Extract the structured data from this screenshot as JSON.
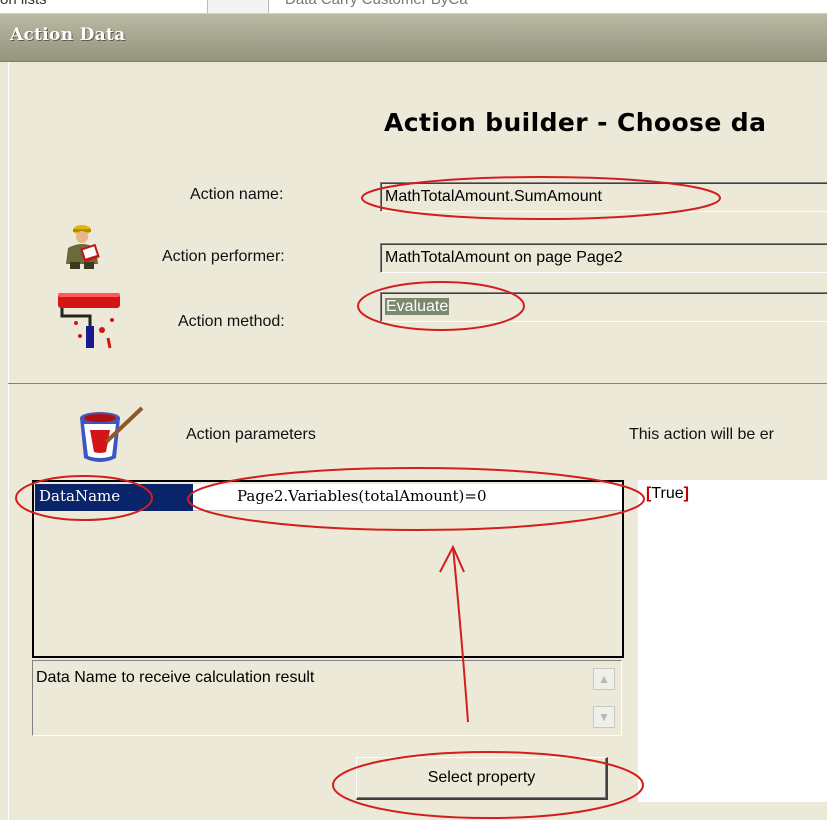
{
  "background_window": {
    "fragment_left": "orl lists",
    "fragment_right": "Data Carry Customer ByCa"
  },
  "window": {
    "title": "Action Data"
  },
  "header": {
    "heading": "Action builder - Choose da"
  },
  "form": {
    "action_name_label": "Action name:",
    "action_name_value": "MathTotalAmount.SumAmount",
    "action_performer_label": "Action performer:",
    "action_performer_value": "MathTotalAmount on page Page2",
    "action_method_label": "Action method:",
    "action_method_value": "Evaluate"
  },
  "parameters": {
    "label": "Action parameters",
    "info_text": "This action will be er",
    "rows": [
      {
        "name": "DataName",
        "value": "Page2.Variables(totalAmount)=0"
      }
    ],
    "description": "Data Name to receive calculation result"
  },
  "condition": {
    "value": "True"
  },
  "buttons": {
    "select_property": "Select property"
  },
  "colors": {
    "annotation_red": "#d21e1e",
    "selection_blue": "#0a246a",
    "dialog_face": "#ece9d8",
    "titlebar": "#a4a48f"
  },
  "icons": [
    "worker-icon",
    "paint-roller-icon",
    "paint-bucket-icon",
    "scroll-up-icon",
    "scroll-down-icon"
  ]
}
